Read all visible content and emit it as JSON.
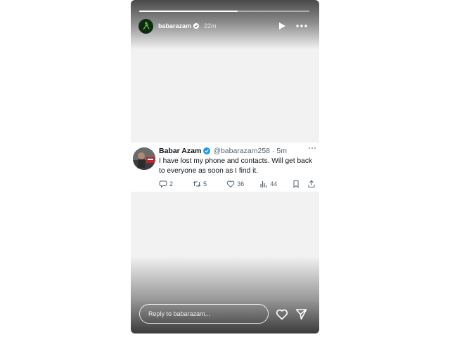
{
  "story": {
    "progress": 0.58,
    "username": "babarazam",
    "time_ago": "22m",
    "icons": {
      "avatar": "profile-avatar",
      "verified": "verified-badge-icon",
      "play": "play-icon",
      "more": "more-icon"
    }
  },
  "tweet": {
    "name": "Babar Azam",
    "handle_time": "@babarazam258 · 5m",
    "text": "I have lost my phone and contacts. Will get back to everyone as soon as I find it.",
    "actions": [
      {
        "icon": "reply-icon",
        "count": "2"
      },
      {
        "icon": "retweet-icon",
        "count": "5"
      },
      {
        "icon": "like-icon",
        "count": "36"
      },
      {
        "icon": "views-icon",
        "count": "44"
      },
      {
        "icon": "bookmark-icon",
        "count": ""
      },
      {
        "icon": "share-icon",
        "count": ""
      }
    ]
  },
  "footer": {
    "reply_placeholder": "Reply to babarazam...",
    "icons": [
      "heart-icon",
      "send-icon"
    ]
  },
  "colors": {
    "verified": "#1d9bf0",
    "text": "#0f1419",
    "muted": "#536471"
  }
}
